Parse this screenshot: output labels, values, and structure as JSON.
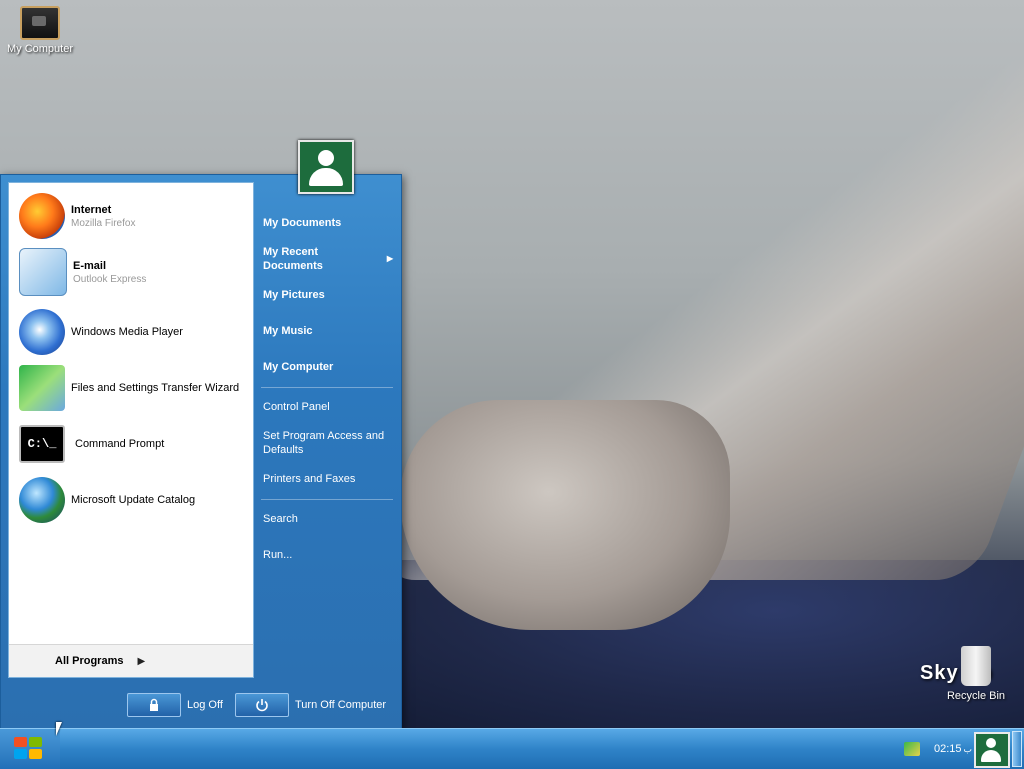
{
  "desktop": {
    "icons": [
      {
        "label": "My Computer",
        "icon": "computer-icon"
      },
      {
        "label": "Recycle Bin",
        "icon": "recycle-bin-icon"
      }
    ],
    "brand": "Sky Xp"
  },
  "start_menu": {
    "user_icon": "user-avatar-icon",
    "pinned": [
      {
        "title": "Internet",
        "subtitle": "Mozilla Firefox",
        "icon": "firefox-icon"
      },
      {
        "title": "E-mail",
        "subtitle": "Outlook Express",
        "icon": "email-icon"
      }
    ],
    "recent": [
      {
        "label": "Windows Media Player",
        "icon": "media-player-icon"
      },
      {
        "label": "Files and Settings Transfer Wizard",
        "icon": "transfer-wizard-icon"
      },
      {
        "label": "Command Prompt",
        "icon": "command-prompt-icon",
        "glyph": "C:\\_"
      },
      {
        "label": "Microsoft Update Catalog",
        "icon": "globe-icon"
      }
    ],
    "all_programs": "All Programs",
    "right": {
      "my_documents": "My Documents",
      "my_recent_documents": "My Recent Documents",
      "my_pictures": "My Pictures",
      "my_music": "My Music",
      "my_computer": "My Computer",
      "control_panel": "Control Panel",
      "set_program_access": "Set Program Access and Defaults",
      "printers_faxes": "Printers and Faxes",
      "search": "Search",
      "run": "Run..."
    },
    "log_off": "Log Off",
    "turn_off": "Turn Off Computer"
  },
  "taskbar": {
    "clock": "02:15",
    "clock_suffix": "ب",
    "colors": {
      "bar": "#2f83c8",
      "start_menu": "#2c78bd",
      "avatar": "#1d6c3d"
    }
  }
}
